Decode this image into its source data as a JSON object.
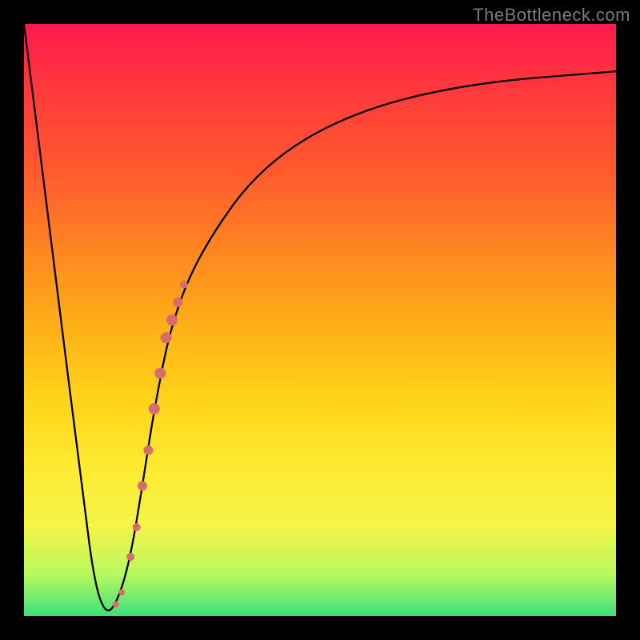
{
  "watermark": "TheBottleneck.com",
  "colors": {
    "frame": "#000000",
    "gradient_top": "#ff1a4d",
    "gradient_bottom": "#3ee07a",
    "curve": "#000000",
    "points": "#d66d6c"
  },
  "chart_data": {
    "type": "line",
    "title": "",
    "xlabel": "",
    "ylabel": "",
    "xlim": [
      0,
      100
    ],
    "ylim": [
      0,
      100
    ],
    "series": [
      {
        "name": "bottleneck-curve",
        "x": [
          0,
          5,
          10,
          12,
          14,
          16,
          18,
          20,
          22,
          25,
          30,
          40,
          55,
          75,
          100
        ],
        "y": [
          100,
          60,
          20,
          5,
          0,
          3,
          10,
          22,
          35,
          50,
          62,
          76,
          85,
          90,
          92
        ]
      }
    ],
    "points": {
      "name": "highlighted-segment",
      "x": [
        15.5,
        16.5,
        18.0,
        19.0,
        20.0,
        21.0,
        22.0,
        23.0,
        24.0,
        25.0,
        26.0,
        27.0
      ],
      "y": [
        2,
        4,
        10,
        15,
        22,
        28,
        35,
        41,
        47,
        50,
        53,
        56
      ],
      "r": [
        4,
        4,
        5,
        5,
        6,
        6,
        7,
        7,
        7,
        7,
        6,
        5
      ]
    }
  }
}
